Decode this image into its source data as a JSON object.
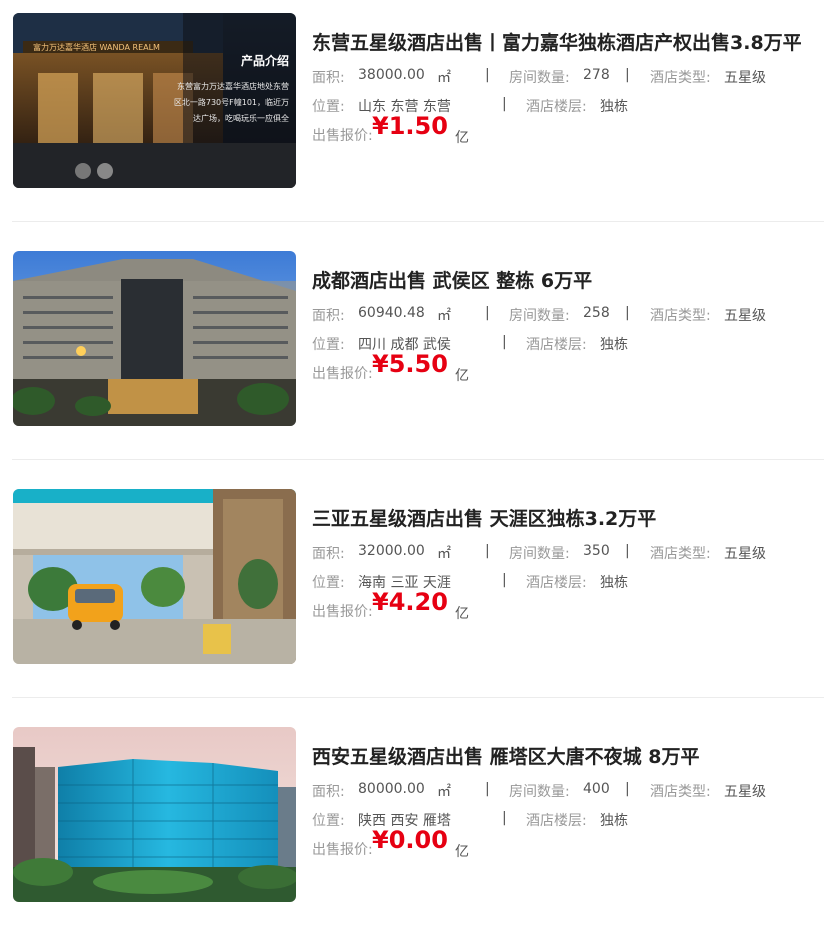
{
  "listings": [
    {
      "title": "东营五星级酒店出售丨富力嘉华独栋酒店产权出售3.8万平",
      "area_label": "面积:",
      "area_value": "38000.00",
      "area_unit": "㎡",
      "rooms_label": "房间数量:",
      "rooms_value": "278",
      "type_label": "酒店类型:",
      "type_value": "五星级",
      "location_label": "位置:",
      "location_value": "山东 东营 东营",
      "floors_label": "酒店楼层:",
      "floors_value": "独栋",
      "price_label": "出售报价:",
      "price_value": "¥1.50",
      "price_unit": "亿",
      "image": {
        "caption_title": "产品介绍",
        "caption_lines": [
          "东营富力万达嘉华酒店地处东营",
          "区北一路730号F幢101，临近万",
          "达广场，吃喝玩乐一应俱全"
        ],
        "sign_text": "富力万达嘉华酒店 WANDA REALM"
      }
    },
    {
      "title": "成都酒店出售 武侯区 整栋 6万平",
      "area_label": "面积:",
      "area_value": "60940.48",
      "area_unit": "㎡",
      "rooms_label": "房间数量:",
      "rooms_value": "258",
      "type_label": "酒店类型:",
      "type_value": "五星级",
      "location_label": "位置:",
      "location_value": "四川 成都 武侯",
      "floors_label": "酒店楼层:",
      "floors_value": "独栋",
      "price_label": "出售报价:",
      "price_value": "¥5.50",
      "price_unit": "亿"
    },
    {
      "title": "三亚五星级酒店出售 天涯区独栋3.2万平",
      "area_label": "面积:",
      "area_value": "32000.00",
      "area_unit": "㎡",
      "rooms_label": "房间数量:",
      "rooms_value": "350",
      "type_label": "酒店类型:",
      "type_value": "五星级",
      "location_label": "位置:",
      "location_value": "海南 三亚 天涯",
      "floors_label": "酒店楼层:",
      "floors_value": "独栋",
      "price_label": "出售报价:",
      "price_value": "¥4.20",
      "price_unit": "亿"
    },
    {
      "title": "西安五星级酒店出售 雁塔区大唐不夜城 8万平",
      "area_label": "面积:",
      "area_value": "80000.00",
      "area_unit": "㎡",
      "rooms_label": "房间数量:",
      "rooms_value": "400",
      "type_label": "酒店类型:",
      "type_value": "五星级",
      "location_label": "位置:",
      "location_value": "陕西 西安 雁塔",
      "floors_label": "酒店楼层:",
      "floors_value": "独栋",
      "price_label": "出售报价:",
      "price_value": "¥0.00",
      "price_unit": "亿"
    }
  ],
  "separator": "|",
  "colors": {
    "price": "#e60012",
    "title": "#222222",
    "label": "#999999",
    "value": "#555555"
  }
}
